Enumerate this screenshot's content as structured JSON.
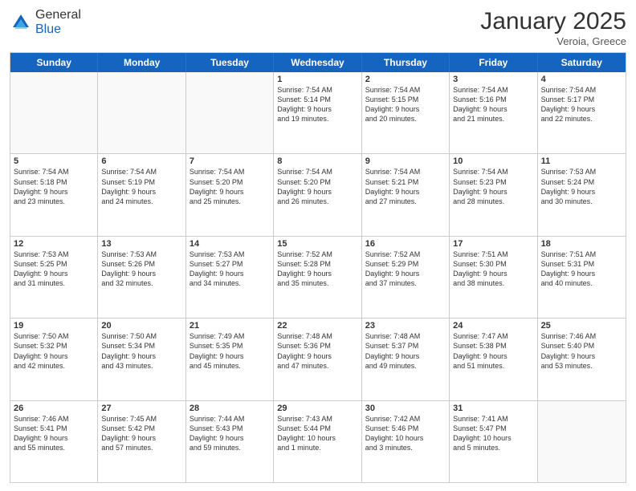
{
  "header": {
    "logo_general": "General",
    "logo_blue": "Blue",
    "month_title": "January 2025",
    "location": "Veroia, Greece"
  },
  "days_of_week": [
    "Sunday",
    "Monday",
    "Tuesday",
    "Wednesday",
    "Thursday",
    "Friday",
    "Saturday"
  ],
  "weeks": [
    [
      {
        "day": "",
        "lines": [],
        "empty": true
      },
      {
        "day": "",
        "lines": [],
        "empty": true
      },
      {
        "day": "",
        "lines": [],
        "empty": true
      },
      {
        "day": "1",
        "lines": [
          "Sunrise: 7:54 AM",
          "Sunset: 5:14 PM",
          "Daylight: 9 hours",
          "and 19 minutes."
        ],
        "empty": false
      },
      {
        "day": "2",
        "lines": [
          "Sunrise: 7:54 AM",
          "Sunset: 5:15 PM",
          "Daylight: 9 hours",
          "and 20 minutes."
        ],
        "empty": false
      },
      {
        "day": "3",
        "lines": [
          "Sunrise: 7:54 AM",
          "Sunset: 5:16 PM",
          "Daylight: 9 hours",
          "and 21 minutes."
        ],
        "empty": false
      },
      {
        "day": "4",
        "lines": [
          "Sunrise: 7:54 AM",
          "Sunset: 5:17 PM",
          "Daylight: 9 hours",
          "and 22 minutes."
        ],
        "empty": false
      }
    ],
    [
      {
        "day": "5",
        "lines": [
          "Sunrise: 7:54 AM",
          "Sunset: 5:18 PM",
          "Daylight: 9 hours",
          "and 23 minutes."
        ],
        "empty": false
      },
      {
        "day": "6",
        "lines": [
          "Sunrise: 7:54 AM",
          "Sunset: 5:19 PM",
          "Daylight: 9 hours",
          "and 24 minutes."
        ],
        "empty": false
      },
      {
        "day": "7",
        "lines": [
          "Sunrise: 7:54 AM",
          "Sunset: 5:20 PM",
          "Daylight: 9 hours",
          "and 25 minutes."
        ],
        "empty": false
      },
      {
        "day": "8",
        "lines": [
          "Sunrise: 7:54 AM",
          "Sunset: 5:20 PM",
          "Daylight: 9 hours",
          "and 26 minutes."
        ],
        "empty": false
      },
      {
        "day": "9",
        "lines": [
          "Sunrise: 7:54 AM",
          "Sunset: 5:21 PM",
          "Daylight: 9 hours",
          "and 27 minutes."
        ],
        "empty": false
      },
      {
        "day": "10",
        "lines": [
          "Sunrise: 7:54 AM",
          "Sunset: 5:23 PM",
          "Daylight: 9 hours",
          "and 28 minutes."
        ],
        "empty": false
      },
      {
        "day": "11",
        "lines": [
          "Sunrise: 7:53 AM",
          "Sunset: 5:24 PM",
          "Daylight: 9 hours",
          "and 30 minutes."
        ],
        "empty": false
      }
    ],
    [
      {
        "day": "12",
        "lines": [
          "Sunrise: 7:53 AM",
          "Sunset: 5:25 PM",
          "Daylight: 9 hours",
          "and 31 minutes."
        ],
        "empty": false
      },
      {
        "day": "13",
        "lines": [
          "Sunrise: 7:53 AM",
          "Sunset: 5:26 PM",
          "Daylight: 9 hours",
          "and 32 minutes."
        ],
        "empty": false
      },
      {
        "day": "14",
        "lines": [
          "Sunrise: 7:53 AM",
          "Sunset: 5:27 PM",
          "Daylight: 9 hours",
          "and 34 minutes."
        ],
        "empty": false
      },
      {
        "day": "15",
        "lines": [
          "Sunrise: 7:52 AM",
          "Sunset: 5:28 PM",
          "Daylight: 9 hours",
          "and 35 minutes."
        ],
        "empty": false
      },
      {
        "day": "16",
        "lines": [
          "Sunrise: 7:52 AM",
          "Sunset: 5:29 PM",
          "Daylight: 9 hours",
          "and 37 minutes."
        ],
        "empty": false
      },
      {
        "day": "17",
        "lines": [
          "Sunrise: 7:51 AM",
          "Sunset: 5:30 PM",
          "Daylight: 9 hours",
          "and 38 minutes."
        ],
        "empty": false
      },
      {
        "day": "18",
        "lines": [
          "Sunrise: 7:51 AM",
          "Sunset: 5:31 PM",
          "Daylight: 9 hours",
          "and 40 minutes."
        ],
        "empty": false
      }
    ],
    [
      {
        "day": "19",
        "lines": [
          "Sunrise: 7:50 AM",
          "Sunset: 5:32 PM",
          "Daylight: 9 hours",
          "and 42 minutes."
        ],
        "empty": false
      },
      {
        "day": "20",
        "lines": [
          "Sunrise: 7:50 AM",
          "Sunset: 5:34 PM",
          "Daylight: 9 hours",
          "and 43 minutes."
        ],
        "empty": false
      },
      {
        "day": "21",
        "lines": [
          "Sunrise: 7:49 AM",
          "Sunset: 5:35 PM",
          "Daylight: 9 hours",
          "and 45 minutes."
        ],
        "empty": false
      },
      {
        "day": "22",
        "lines": [
          "Sunrise: 7:48 AM",
          "Sunset: 5:36 PM",
          "Daylight: 9 hours",
          "and 47 minutes."
        ],
        "empty": false
      },
      {
        "day": "23",
        "lines": [
          "Sunrise: 7:48 AM",
          "Sunset: 5:37 PM",
          "Daylight: 9 hours",
          "and 49 minutes."
        ],
        "empty": false
      },
      {
        "day": "24",
        "lines": [
          "Sunrise: 7:47 AM",
          "Sunset: 5:38 PM",
          "Daylight: 9 hours",
          "and 51 minutes."
        ],
        "empty": false
      },
      {
        "day": "25",
        "lines": [
          "Sunrise: 7:46 AM",
          "Sunset: 5:40 PM",
          "Daylight: 9 hours",
          "and 53 minutes."
        ],
        "empty": false
      }
    ],
    [
      {
        "day": "26",
        "lines": [
          "Sunrise: 7:46 AM",
          "Sunset: 5:41 PM",
          "Daylight: 9 hours",
          "and 55 minutes."
        ],
        "empty": false
      },
      {
        "day": "27",
        "lines": [
          "Sunrise: 7:45 AM",
          "Sunset: 5:42 PM",
          "Daylight: 9 hours",
          "and 57 minutes."
        ],
        "empty": false
      },
      {
        "day": "28",
        "lines": [
          "Sunrise: 7:44 AM",
          "Sunset: 5:43 PM",
          "Daylight: 9 hours",
          "and 59 minutes."
        ],
        "empty": false
      },
      {
        "day": "29",
        "lines": [
          "Sunrise: 7:43 AM",
          "Sunset: 5:44 PM",
          "Daylight: 10 hours",
          "and 1 minute."
        ],
        "empty": false
      },
      {
        "day": "30",
        "lines": [
          "Sunrise: 7:42 AM",
          "Sunset: 5:46 PM",
          "Daylight: 10 hours",
          "and 3 minutes."
        ],
        "empty": false
      },
      {
        "day": "31",
        "lines": [
          "Sunrise: 7:41 AM",
          "Sunset: 5:47 PM",
          "Daylight: 10 hours",
          "and 5 minutes."
        ],
        "empty": false
      },
      {
        "day": "",
        "lines": [],
        "empty": true
      }
    ]
  ]
}
